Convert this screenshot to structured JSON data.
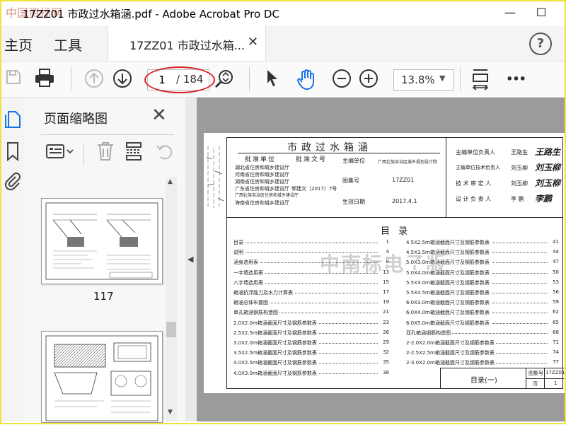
{
  "window": {
    "title": "17ZZ01 市政过水箱涵.pdf - Adobe Acrobat Pro DC",
    "watermark": "中国资标网",
    "min": "—",
    "max": "☐"
  },
  "menu": {
    "home": "主页",
    "tools": "工具"
  },
  "tab": {
    "label": "17ZZ01 市政过水箱...",
    "close": "✕"
  },
  "help": "?",
  "toolbar": {
    "page_current": "1",
    "page_total": "/ 184",
    "zoom": "13.8%",
    "more": "•••"
  },
  "panel": {
    "title": "页面缩略图",
    "close": "✕",
    "page_label_1": "117"
  },
  "drawing": {
    "title": "市政过水箱涵",
    "approve_unit_h": "批准单位",
    "approve_doc_h": "批准文号",
    "approve_units": [
      "湖北省住房和城乡建设厅",
      "河南省住房和城乡建设厅",
      "湖南省住房和城乡建设厅",
      "广东省住房和城乡建设厅",
      "广西壮族自治区住房和城乡建设厅",
      "海南省住房和城乡建设厅"
    ],
    "doc_no": "鄂建文〔2017〕7号",
    "editor_h": "主编单位",
    "editor": "广西壮族自治区城乡规划设计院",
    "atlas_h": "图集号",
    "atlas_no": "17ZZ01",
    "date_h": "生效日期",
    "date": "2017.4.1",
    "roles": [
      {
        "role": "主编单位负责人",
        "name": "王路生",
        "sig": "王路生"
      },
      {
        "role": "主编单位技术负责人",
        "name": "刘玉柳",
        "sig": "刘玉柳"
      },
      {
        "role": "技 术 审 定 人",
        "name": "刘玉柳",
        "sig": "刘玉柳"
      },
      {
        "role": "设 计 负 责 人",
        "name": "李 鹏",
        "sig": "李鹏"
      }
    ],
    "toc_title": "目 录",
    "watermark": "中南标电子版",
    "toc_left": [
      {
        "t": "目录",
        "p": "1"
      },
      {
        "t": "说明",
        "p": "4"
      },
      {
        "t": "涵身选用表",
        "p": "8"
      },
      {
        "t": "一字墙选用表",
        "p": "13"
      },
      {
        "t": "八字墙选用表",
        "p": "15"
      },
      {
        "t": "箱涵抗浮能力及水力计算表",
        "p": "17"
      },
      {
        "t": "箱涵总体布置图",
        "p": "19"
      },
      {
        "t": "单孔箱涵钢筋构造图",
        "p": "21"
      },
      {
        "t": "2.0X2.0m箱涵截面尺寸及钢筋参数表",
        "p": "23"
      },
      {
        "t": "2.5X2.5m箱涵截面尺寸及钢筋参数表",
        "p": "26"
      },
      {
        "t": "3.0X2.0m箱涵截面尺寸及钢筋参数表",
        "p": "29"
      },
      {
        "t": "3.5X2.5m箱涵截面尺寸及钢筋参数表",
        "p": "32"
      },
      {
        "t": "4.0X2.5m箱涵截面尺寸及钢筋参数表",
        "p": "35"
      },
      {
        "t": "4.0X3.0m箱涵截面尺寸及钢筋参数表",
        "p": "38"
      }
    ],
    "toc_right": [
      {
        "t": "4.5X2.5m箱涵截面尺寸及钢筋参数表",
        "p": "41"
      },
      {
        "t": "4.5X3.5m箱涵截面尺寸及钢筋参数表",
        "p": "44"
      },
      {
        "t": "5.0X3.0m箱涵截面尺寸及钢筋参数表",
        "p": "47"
      },
      {
        "t": "5.0X4.0m箱涵截面尺寸及钢筋参数表",
        "p": "50"
      },
      {
        "t": "5.5X3.0m箱涵截面尺寸及钢筋参数表",
        "p": "53"
      },
      {
        "t": "5.5X4.5m箱涵截面尺寸及钢筋参数表",
        "p": "56"
      },
      {
        "t": "6.0X3.0m箱涵截面尺寸及钢筋参数表",
        "p": "59"
      },
      {
        "t": "6.0X4.0m箱涵截面尺寸及钢筋参数表",
        "p": "62"
      },
      {
        "t": "6.0X5.0m箱涵截面尺寸及钢筋参数表",
        "p": "65"
      },
      {
        "t": "双孔箱涵钢筋构造图",
        "p": "68"
      },
      {
        "t": "2-2.0X2.0m箱涵截面尺寸及钢筋参数表",
        "p": "71"
      },
      {
        "t": "2-2.5X2.5m箱涵截面尺寸及钢筋参数表",
        "p": "74"
      },
      {
        "t": "2-3.0X2.0m箱涵截面尺寸及钢筋参数表",
        "p": "77"
      }
    ],
    "footer_title": "目录(一)",
    "footer_atlas_h": "图集号",
    "footer_atlas": "17ZZ01",
    "footer_page_h": "页",
    "footer_page": "1"
  },
  "colors": {
    "accent": "#1473e6",
    "oval": "#d92020",
    "frame": "#f2e33a"
  }
}
